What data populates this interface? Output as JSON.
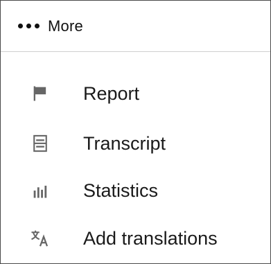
{
  "header": {
    "label": "More",
    "icon": "more-horizontal-icon"
  },
  "menu": {
    "items": [
      {
        "label": "Report",
        "icon": "flag-icon"
      },
      {
        "label": "Transcript",
        "icon": "transcript-icon"
      },
      {
        "label": "Statistics",
        "icon": "bar-chart-icon"
      },
      {
        "label": "Add translations",
        "icon": "translate-icon"
      }
    ]
  },
  "colors": {
    "text": "#1a1a1a",
    "icon": "#666666",
    "divider": "#cfcfcf",
    "border": "#4a4a4a"
  }
}
